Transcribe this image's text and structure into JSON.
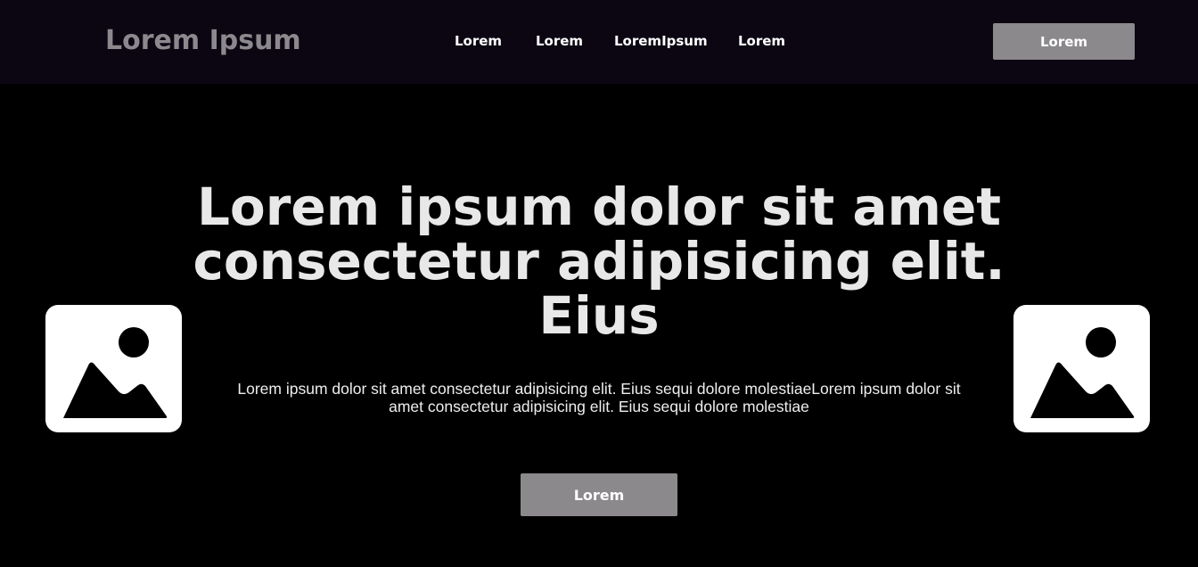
{
  "header": {
    "logo": "Lorem Ipsum",
    "nav": [
      "Lorem",
      "Lorem",
      "LoremIpsum",
      "Lorem"
    ],
    "cta_label": "Lorem"
  },
  "hero": {
    "title": "Lorem ipsum dolor sit amet consectetur adipisicing elit. Eius",
    "text": "Lorem ipsum dolor sit amet consectetur adipisicing elit. Eius sequi dolore molestiaeLorem ipsum dolor sit amet consectetur adipisicing elit. Eius sequi dolore molestiae",
    "cta_label": "Lorem"
  },
  "images": {
    "left_icon": "image-icon",
    "right_icon": "image-icon"
  },
  "colors": {
    "background": "#000000",
    "header_background": "#0b0612",
    "button": "#8b898c",
    "logo": "#8b898d",
    "title": "#e8e8e8"
  }
}
